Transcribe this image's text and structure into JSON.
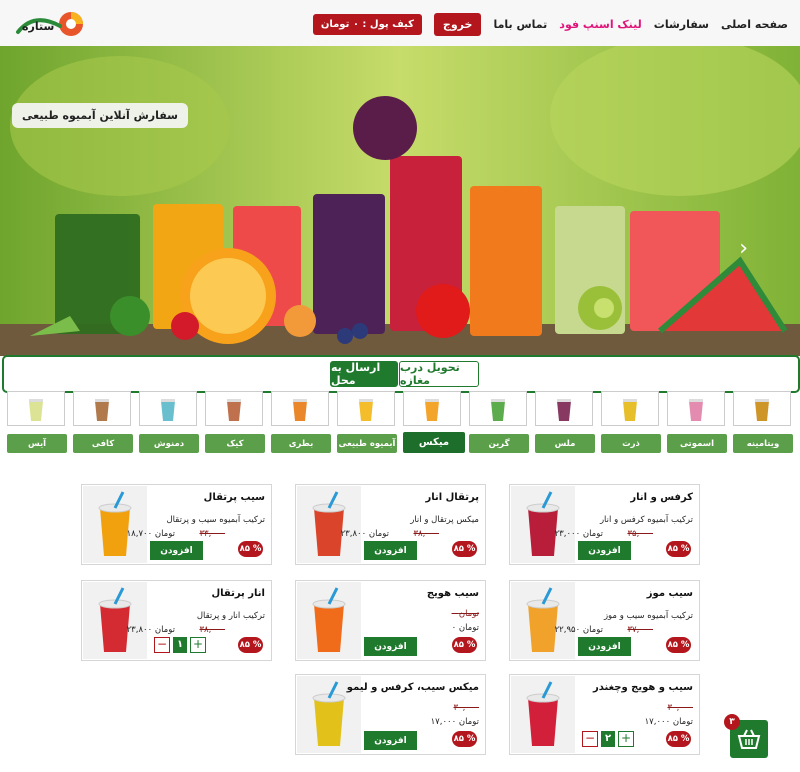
{
  "header": {
    "logo_text": "ستاره",
    "nav": [
      "صفحه اصلی",
      "سفارشات",
      "لینک اسنپ فود",
      "تماس باما"
    ],
    "exit_label": "خروج",
    "wallet_label": "کیف پول : ۰ تومان"
  },
  "hero": {
    "title": "سفارش آنلاین آبمیوه طبیعی"
  },
  "delivery": {
    "store_label": "تحویل درب مغازه",
    "send_label": "ارسال به محل"
  },
  "category_icons": [
    "bowl-icon",
    "shake-icon",
    "corn-icon",
    "jar-icon",
    "green-juice-icon",
    "orange-juice-icon",
    "yellow-juice-icon",
    "bottle-icon",
    "cake-icon",
    "cup-icon",
    "coffee-icon",
    "glass-icon"
  ],
  "categories": [
    "ویتامینه",
    "اسموتی",
    "ذرت",
    "ملس",
    "گرین",
    "میکس",
    "آبمیوه طبیعی",
    "بطری",
    "کیک",
    "دمنوش",
    "کافی",
    "آیس"
  ],
  "active_category": "میکس",
  "products": [
    {
      "name": "کرفس و انار",
      "desc": "ترکیب آبمیوه کرفس و انار",
      "old": "۳۵,۰۰۰",
      "new": "۲۳,۰۰۰ تومان",
      "badge": "۸۵ %",
      "action": "افزودن",
      "color": "#b81d3a"
    },
    {
      "name": "پرتقال انار",
      "desc": "میکس پرتقال و انار",
      "old": "۳۸,۰۰۰",
      "new": "۲۳,۸۰۰ تومان",
      "badge": "۸۵ %",
      "action": "افزودن",
      "color": "#d9442a"
    },
    {
      "name": "سیب پرتقال",
      "desc": "ترکیب آبمیوه سیب و پرتقال",
      "old": "۳۳,۰۰۰",
      "new": "۱۸,۷۰۰ تومان",
      "badge": "۸۵ %",
      "action": "افزودن",
      "color": "#f2a10e"
    },
    {
      "name": "سیب موز",
      "desc": "ترکیب آبمیوه سیب و موز",
      "old": "۳۷,۰۰۰",
      "new": "۲۲,۹۵۰ تومان",
      "badge": "۸۵ %",
      "action": "افزودن",
      "color": "#f0a22a"
    },
    {
      "name": "سیب هویج",
      "desc": "",
      "old": "۰ تومان",
      "new": "۰ تومان",
      "badge": "۸۵ %",
      "action": "افزودن",
      "color": "#f06b1a"
    },
    {
      "name": "انار پرتقال",
      "desc": "ترکیب انار و پرتقال",
      "old": "۳۸,۰۰۰",
      "new": "۲۳,۸۰۰ تومان",
      "badge": "۸۵ %",
      "action": "",
      "qty": "۱",
      "color": "#d42a32"
    },
    {
      "name": "سیب و هویج وچغندر",
      "desc": "",
      "old": "۳۰,۰۰۰",
      "new": "۱۷,۰۰۰ تومان",
      "badge": "۸۵ %",
      "action": "",
      "qty": "۲",
      "color": "#d3203a"
    },
    {
      "name": "میکس سیب، کرفس و لیمو",
      "desc": "",
      "old": "۳۰,۰۰۰",
      "new": "۱۷,۰۰۰ تومان",
      "badge": "۸۵ %",
      "action": "افزودن",
      "color": "#e2c21a"
    }
  ],
  "cart": {
    "count": "۳"
  },
  "colors": {
    "brand_green": "#1f7a2e",
    "tab_green": "#5c9f4a",
    "accent_red": "#b3171d"
  }
}
